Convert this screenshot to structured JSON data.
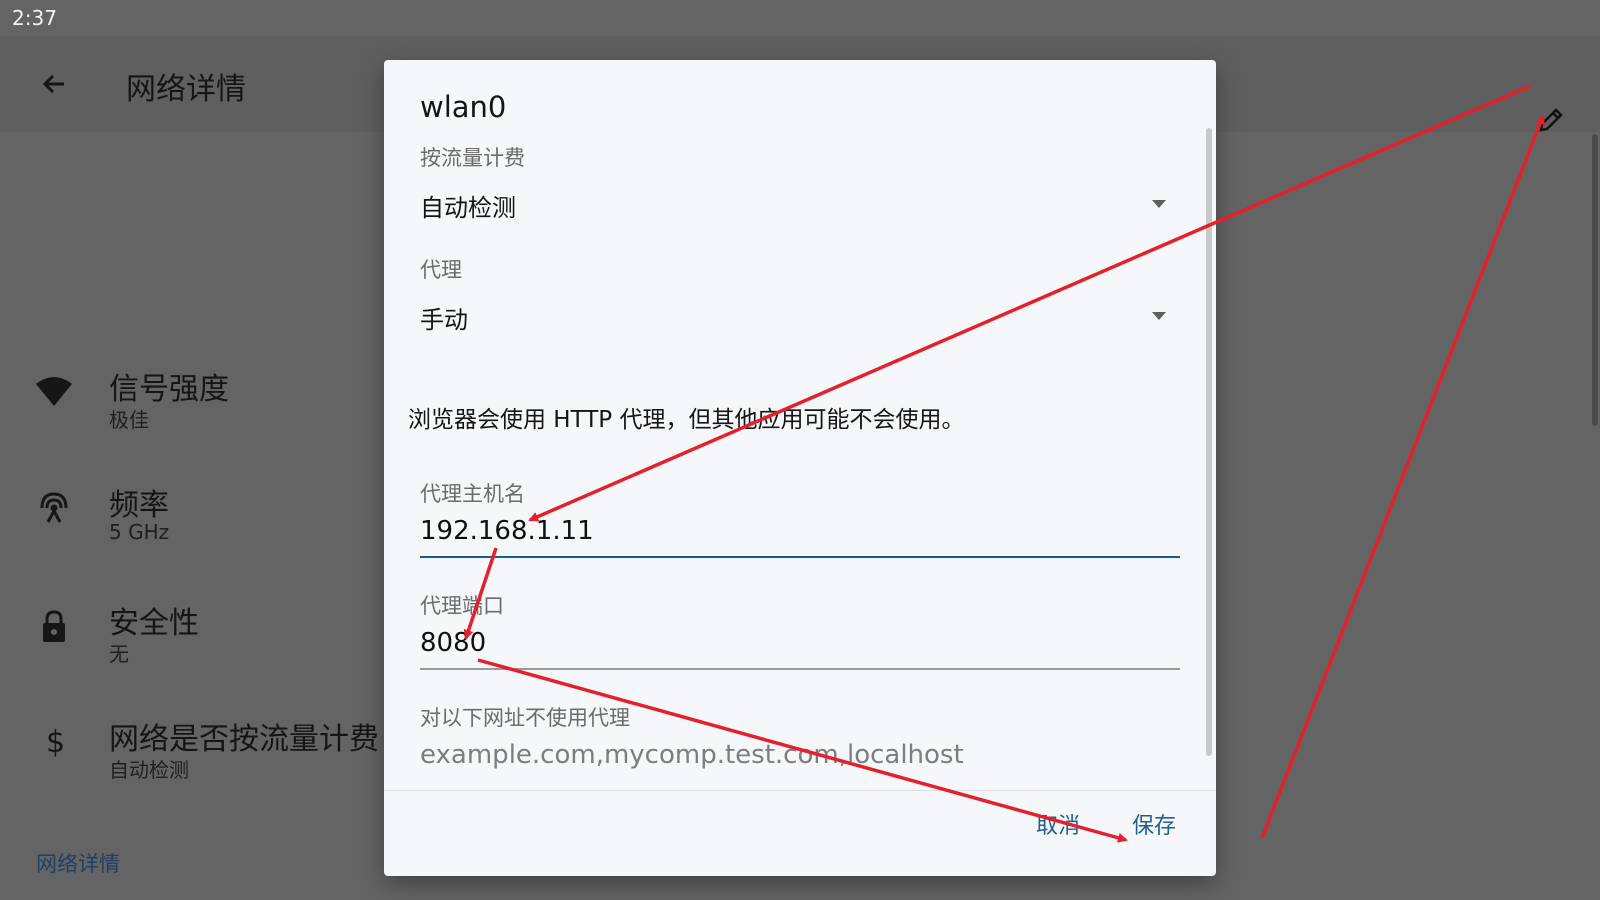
{
  "status_bar": {
    "time": "2:37"
  },
  "app_bar": {
    "title": "网络详情",
    "back_icon": "arrow-back-icon",
    "edit_icon": "pencil-icon"
  },
  "details": [
    {
      "icon": "wifi-signal-icon",
      "title": "信号强度",
      "value": "极佳"
    },
    {
      "icon": "frequency-icon",
      "title": "频率",
      "value": "5 GHz"
    },
    {
      "icon": "lock-icon",
      "title": "安全性",
      "value": "无"
    },
    {
      "icon": "dollar-icon",
      "title": "网络是否按流量计费",
      "value": "自动检测"
    }
  ],
  "section_header": "网络详情",
  "dialog": {
    "title": "wlan0",
    "metered": {
      "label": "按流量计费",
      "value": "自动检测"
    },
    "proxy": {
      "label": "代理",
      "value": "手动"
    },
    "proxy_hint": "浏览器会使用 HTTP 代理，但其他应用可能不会使用。",
    "proxy_hostname": {
      "label": "代理主机名",
      "value": "192.168.1.11"
    },
    "proxy_port": {
      "label": "代理端口",
      "value": "8080"
    },
    "bypass": {
      "label": "对以下网址不使用代理",
      "placeholder": "example.com,mycomp.test.com,localhost"
    },
    "cancel_label": "取消",
    "save_label": "保存"
  },
  "colors": {
    "annotation_arrow": "#e3212b",
    "accent": "#1c5c8c",
    "scrim": "#646464"
  }
}
